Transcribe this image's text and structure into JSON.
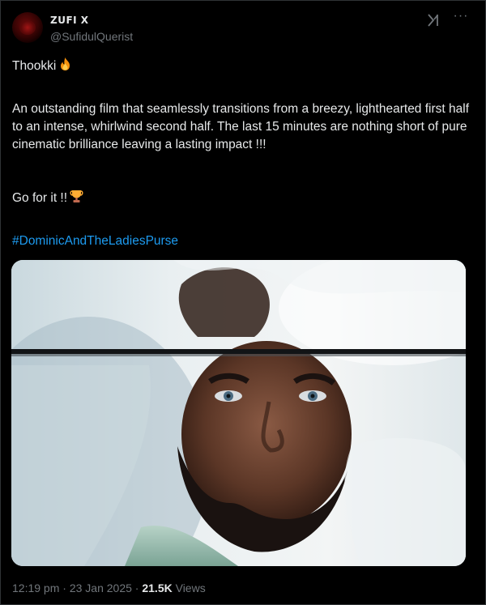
{
  "author": {
    "display_name": "ZUFI X",
    "handle": "@SufidulQuerist"
  },
  "icons": {
    "avatar": "avatar-image",
    "grok": "grok-icon",
    "more": "more-options-icon",
    "fire": "fire-emoji",
    "trophy": "trophy-emoji"
  },
  "tweet": {
    "line1": "Thookki",
    "paragraph": "An outstanding film that seamlessly transitions from a breezy, lighthearted first half to an intense, whirlwind second half. The last 15 minutes are nothing short of pure cinematic brilliance leaving a lasting impact !!!",
    "line3": "Go for it !!",
    "hashtag": "#DominicAndTheLadiesPurse"
  },
  "meta": {
    "time": "12:19 pm",
    "separator": "·",
    "date": "23 Jan 2025",
    "views_count": "21.5K",
    "views_label": "Views"
  },
  "colors": {
    "background": "#000000",
    "text": "#e7e9ea",
    "muted": "#71767b",
    "link": "#1d9bf0"
  }
}
